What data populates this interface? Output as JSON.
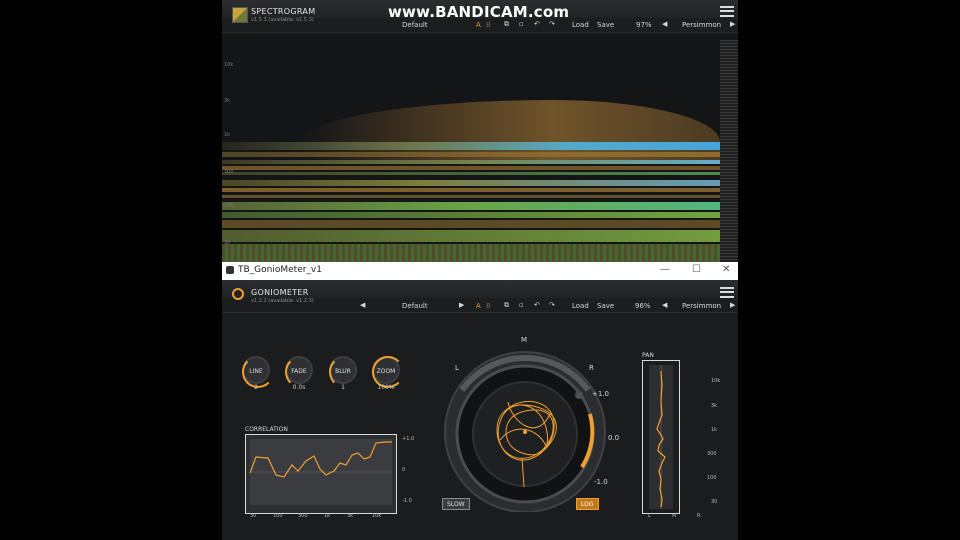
{
  "spectrogram": {
    "title": "SPECTROGRAM",
    "version": "v1.5.3 (available: v1.5.3)",
    "preset": "Default",
    "ab": {
      "a": "A",
      "b": "B"
    },
    "load": "Load",
    "save": "Save",
    "zoom": "97%",
    "theme": "Persimmon",
    "freq_labels": [
      "10k",
      "3k",
      "1k",
      "300",
      "100",
      "30"
    ]
  },
  "watermark": "www.BANDICAM.com",
  "window": {
    "title": "TB_GonioMeter_v1",
    "min_glyph": "—",
    "max_glyph": "☐",
    "close_glyph": "✕"
  },
  "goniometer": {
    "title": "GONIOMETER",
    "version": "v1.2.2 (available: v1.2.3)",
    "preset": "Default",
    "ab": {
      "a": "A",
      "b": "B"
    },
    "load": "Load",
    "save": "Save",
    "zoom": "96%",
    "theme": "Persimmon",
    "knobs": [
      {
        "label": "LINE",
        "value": "2"
      },
      {
        "label": "FADE",
        "value": "0.0s"
      },
      {
        "label": "BLUR",
        "value": "1"
      },
      {
        "label": "ZOOM",
        "value": "100%"
      }
    ],
    "vector": {
      "m": "M",
      "l": "L",
      "r": "R",
      "plus1": "+1.0",
      "zero": "0.0",
      "minus1": "-1.0"
    },
    "buttons": {
      "slow": "SLOW",
      "log": "LOG"
    },
    "correlation": {
      "label": "CORRELATION",
      "y_labels": [
        "+1.0",
        "0",
        "-1.0"
      ],
      "x_labels": [
        "30",
        "100",
        "300",
        "1k",
        "3k",
        "10k"
      ]
    },
    "pan": {
      "label": "PAN",
      "freq_labels": [
        "10k",
        "3k",
        "1k",
        "300",
        "100",
        "30"
      ],
      "lcr": [
        "L",
        "M",
        "R"
      ]
    }
  },
  "colors": {
    "accent": "#f0a030",
    "background": "#1b1c1e"
  }
}
